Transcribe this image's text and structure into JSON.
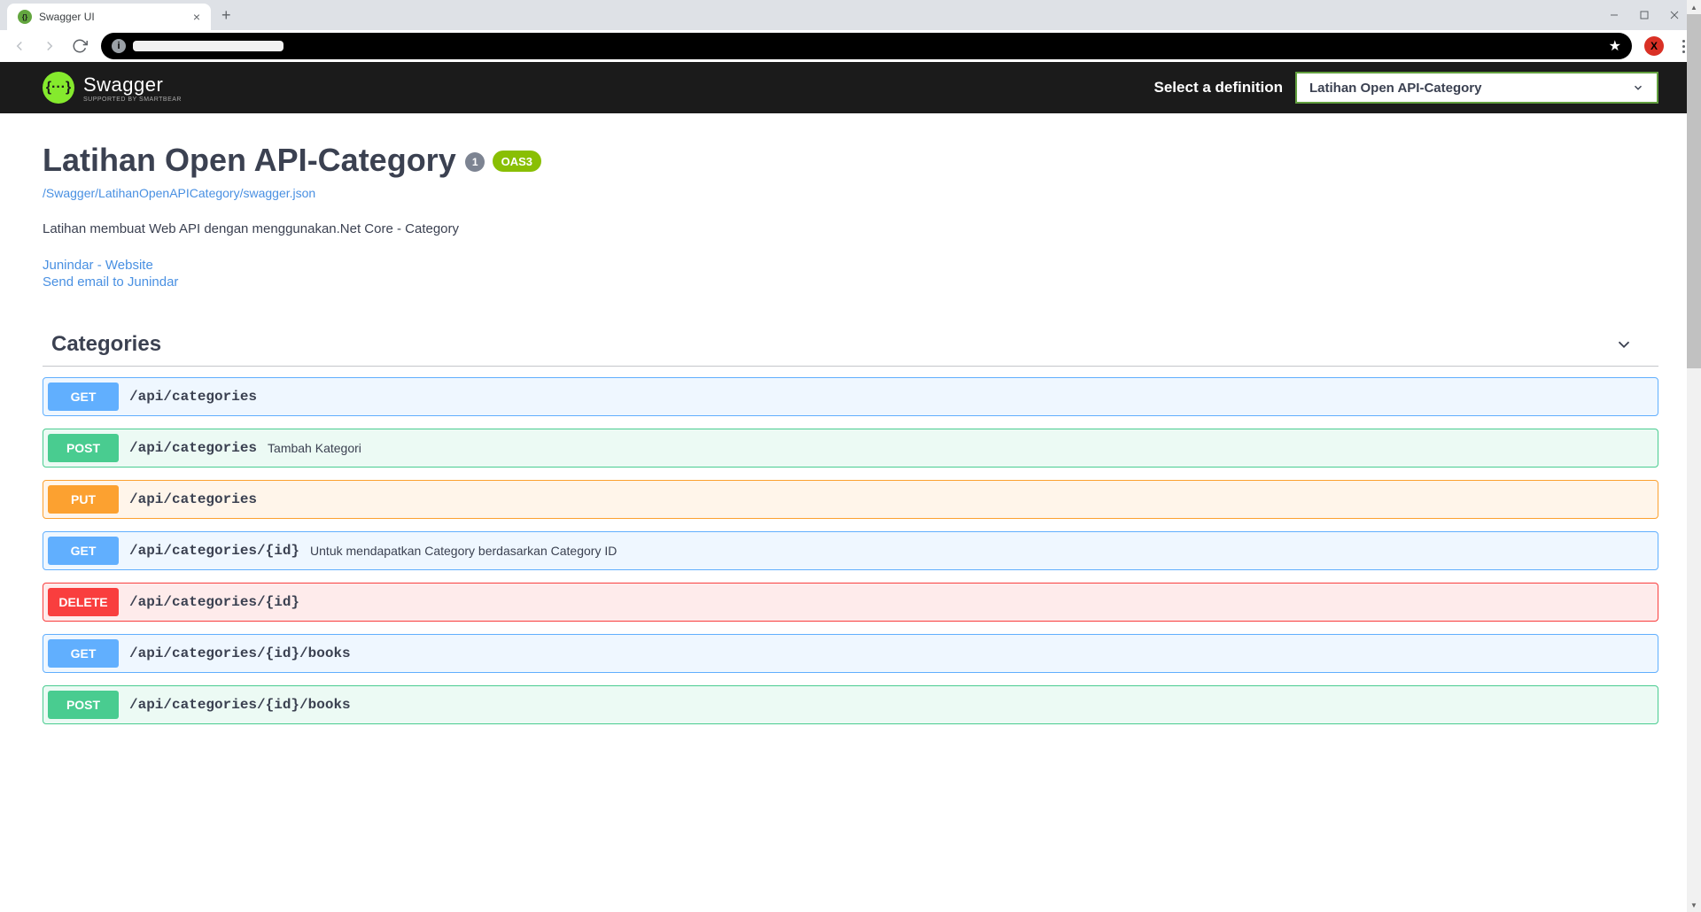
{
  "browser": {
    "tab_title": "Swagger UI"
  },
  "header": {
    "logo_text": "Swagger",
    "logo_subtext": "Supported by SMARTBEAR",
    "definition_label": "Select a definition",
    "definition_value": "Latihan Open API-Category"
  },
  "api": {
    "title": "Latihan Open API-Category",
    "version": "1",
    "oas": "OAS3",
    "spec_url": "/Swagger/LatihanOpenAPICategory/swagger.json",
    "description": "Latihan membuat Web API dengan menggunakan.Net Core - Category",
    "contact_website": "Junindar - Website",
    "contact_email": "Send email to Junindar"
  },
  "tag": {
    "name": "Categories"
  },
  "operations": [
    {
      "method": "GET",
      "method_class": "get",
      "path": "/api/categories",
      "desc": ""
    },
    {
      "method": "POST",
      "method_class": "post",
      "path": "/api/categories",
      "desc": "Tambah Kategori"
    },
    {
      "method": "PUT",
      "method_class": "put",
      "path": "/api/categories",
      "desc": ""
    },
    {
      "method": "GET",
      "method_class": "get",
      "path": "/api/categories/{id}",
      "desc": "Untuk mendapatkan Category berdasarkan Category ID"
    },
    {
      "method": "DELETE",
      "method_class": "delete",
      "path": "/api/categories/{id}",
      "desc": ""
    },
    {
      "method": "GET",
      "method_class": "get",
      "path": "/api/categories/{id}/books",
      "desc": ""
    },
    {
      "method": "POST",
      "method_class": "post",
      "path": "/api/categories/{id}/books",
      "desc": ""
    }
  ]
}
